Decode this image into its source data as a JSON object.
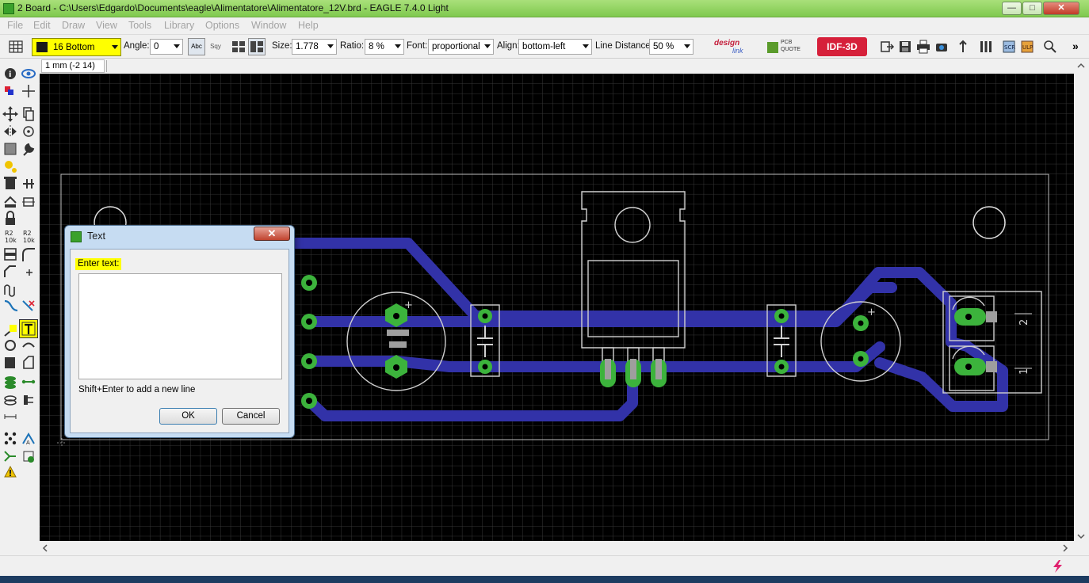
{
  "window": {
    "title": "2 Board - C:\\Users\\Edgardo\\Documents\\eagle\\Alimentatore\\Alimentatore_12V.brd - EAGLE 7.4.0 Light",
    "minimize": "—",
    "maximize": "□",
    "close": "✕"
  },
  "menu": {
    "items": [
      "File",
      "Edit",
      "Draw",
      "View",
      "Tools",
      "Library",
      "Options",
      "Window",
      "Help"
    ]
  },
  "params": {
    "layer": "16 Bottom",
    "angle_label": "Angle:",
    "angle": "0",
    "size_label": "Size:",
    "size": "1.778",
    "ratio_label": "Ratio:",
    "ratio": "8 %",
    "font_label": "Font:",
    "font": "proportional",
    "align_label": "Align:",
    "align": "bottom-left",
    "line_distance_label": "Line Distance:",
    "line_distance": "50 %",
    "abc_label": "Abc",
    "mirror_label": "Sqy",
    "designlink_a": "design",
    "designlink_b": "link",
    "pcbquote_a": "PCB",
    "pcbquote_b": "QUOTE",
    "idf3d": "IDF-3D",
    "more": "»"
  },
  "coord": {
    "readout": "1 mm (-2 14)"
  },
  "dialog": {
    "title": "Text",
    "label": "Enter text:",
    "value": "",
    "hint": "Shift+Enter to add a new line",
    "ok": "OK",
    "cancel": "Cancel",
    "close": "✕"
  },
  "board": {
    "cap_polarity": "+",
    "cap2_polarity": "+",
    "connector_pins": [
      "2",
      "1"
    ]
  },
  "colors": {
    "canvas": "#000000",
    "grid": "#333333",
    "trace": "#3232a8",
    "pad": "#3cb33c",
    "silk": "#c8c8c8",
    "highlight": "#ffff00",
    "idf": "#d6203a",
    "title_bar": "#8fd162"
  }
}
